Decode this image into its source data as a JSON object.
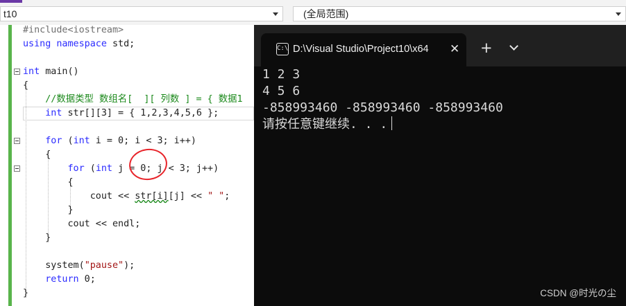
{
  "toolbar": {
    "project_combo": "t10",
    "scope_combo": "(全局范围)"
  },
  "editor": {
    "lines": [
      {
        "t": "#include<iostream>"
      },
      {
        "t": "using namespace std;"
      },
      {
        "t": ""
      },
      {
        "t": "int main()"
      },
      {
        "t": "{"
      },
      {
        "t": "    //数据类型 数组名[  ][ 列数 ] = { 数据1"
      },
      {
        "t": "    int str[][3] = { 1,2,3,4,5,6 };"
      },
      {
        "t": ""
      },
      {
        "t": "    for (int i = 0; i < 3; i++)"
      },
      {
        "t": "    {"
      },
      {
        "t": "        for (int j = 0; j < 3; j++)"
      },
      {
        "t": "        {"
      },
      {
        "t": "            cout << str[i][j] << \" \";"
      },
      {
        "t": "        }"
      },
      {
        "t": "        cout << endl;"
      },
      {
        "t": "    }"
      },
      {
        "t": ""
      },
      {
        "t": "    system(\"pause\");"
      },
      {
        "t": "    return 0;"
      },
      {
        "t": "}"
      }
    ],
    "colors": {
      "keyword": "#2b2bff",
      "comment": "#1d8a1d",
      "string": "#a31515",
      "annotation_circle": "#e8242a"
    }
  },
  "console": {
    "tab_title": "D:\\Visual Studio\\Project10\\x64",
    "tab_icon_glyph": "C:\\",
    "new_tab": "+",
    "close": "✕",
    "output": [
      "1 2 3",
      "4 5 6",
      "-858993460 -858993460 -858993460",
      "请按任意键继续. . ."
    ]
  },
  "watermark": "CSDN @时光の尘"
}
